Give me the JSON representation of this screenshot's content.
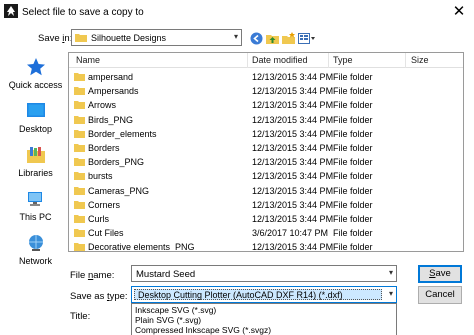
{
  "window": {
    "title": "Select file to save a copy to",
    "close_glyph": "✕"
  },
  "save_in": {
    "label_pre": "Save ",
    "label_ul": "i",
    "label_post": "n:",
    "current_folder": "Silhouette Designs",
    "arrow": "▾"
  },
  "toolbar": {
    "icons": [
      "back-icon",
      "up-folder-icon",
      "new-folder-icon",
      "view-menu-icon"
    ]
  },
  "places": [
    {
      "label": "Quick access",
      "icon": "star-icon"
    },
    {
      "label": "Desktop",
      "icon": "desktop-icon"
    },
    {
      "label": "Libraries",
      "icon": "libraries-icon"
    },
    {
      "label": "This PC",
      "icon": "computer-icon"
    },
    {
      "label": "Network",
      "icon": "network-icon"
    }
  ],
  "file_list": {
    "columns": [
      "Name",
      "Date modified",
      "Type",
      "Size"
    ],
    "rows": [
      {
        "name": "ampersand",
        "date": "12/13/2015 3:44 PM",
        "type": "File folder"
      },
      {
        "name": "Ampersands",
        "date": "12/13/2015 3:44 PM",
        "type": "File folder"
      },
      {
        "name": "Arrows",
        "date": "12/13/2015 3:44 PM",
        "type": "File folder"
      },
      {
        "name": "Birds_PNG",
        "date": "12/13/2015 3:44 PM",
        "type": "File folder"
      },
      {
        "name": "Border_elements",
        "date": "12/13/2015 3:44 PM",
        "type": "File folder"
      },
      {
        "name": "Borders",
        "date": "12/13/2015 3:44 PM",
        "type": "File folder"
      },
      {
        "name": "Borders_PNG",
        "date": "12/13/2015 3:44 PM",
        "type": "File folder"
      },
      {
        "name": "bursts",
        "date": "12/13/2015 3:44 PM",
        "type": "File folder"
      },
      {
        "name": "Cameras_PNG",
        "date": "12/13/2015 3:44 PM",
        "type": "File folder"
      },
      {
        "name": "Corners",
        "date": "12/13/2015 3:44 PM",
        "type": "File folder"
      },
      {
        "name": "Curls",
        "date": "12/13/2015 3:44 PM",
        "type": "File folder"
      },
      {
        "name": "Cut Files",
        "date": "3/6/2017 10:47 PM",
        "type": "File folder"
      },
      {
        "name": "Decorative elements_PNG",
        "date": "12/13/2015 3:44 PM",
        "type": "File folder"
      }
    ]
  },
  "form": {
    "file_name_label_pre": "File ",
    "file_name_label_ul": "n",
    "file_name_label_post": "ame:",
    "file_name_value": "Mustard Seed",
    "save_as_type_label_pre": "Save as ",
    "save_as_type_label_ul": "t",
    "save_as_type_label_post": "ype:",
    "save_as_type_value": "Desktop Cutting Plotter (AutoCAD DXF R14) (*.dxf)",
    "title_label": "Title:",
    "type_options": [
      "Inkscape SVG (*.svg)",
      "Plain SVG (*.svg)",
      "Compressed Inkscape SVG (*.svgz)"
    ],
    "arrow": "▾"
  },
  "buttons": {
    "save_pre": "",
    "save_ul": "S",
    "save_post": "ave",
    "cancel": "Cancel"
  },
  "colors": {
    "folder": "#f0c850",
    "accent": "#0078d7",
    "selection": "#cce8ff"
  }
}
